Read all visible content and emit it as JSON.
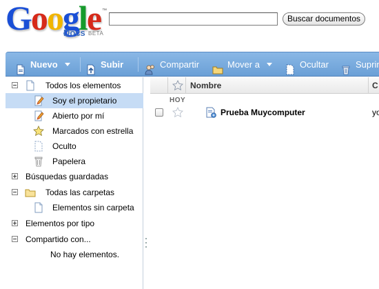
{
  "logo": {
    "word": "Google",
    "tm": "™",
    "product": "Docs",
    "badge": "BETA"
  },
  "search": {
    "value": "",
    "button_label": "Buscar documentos"
  },
  "toolbar": {
    "new_label": "Nuevo",
    "upload_label": "Subir",
    "share_label": "Compartir",
    "move_label": "Mover a",
    "hide_label": "Ocultar",
    "delete_label": "Suprimir"
  },
  "sidebar": {
    "all_items": "Todos los elementos",
    "owned_by_me": "Soy el propietario",
    "opened_by_me": "Abierto por mí",
    "starred": "Marcados con estrella",
    "hidden": "Oculto",
    "trash": "Papelera",
    "saved_searches": "Búsquedas guardadas",
    "all_folders": "Todas las carpetas",
    "no_folder": "Elementos sin carpeta",
    "by_type": "Elementos por tipo",
    "shared_with": "Compartido con...",
    "no_items": "No hay elementos."
  },
  "list": {
    "col_name": "Nombre",
    "col_next": "C",
    "group": "HOY",
    "rows": [
      {
        "title": "Prueba Muycomputer",
        "owner": "yo"
      }
    ]
  },
  "colors": {
    "toolbar": "#7aaee0",
    "selected_row": "#c6dcf5"
  }
}
